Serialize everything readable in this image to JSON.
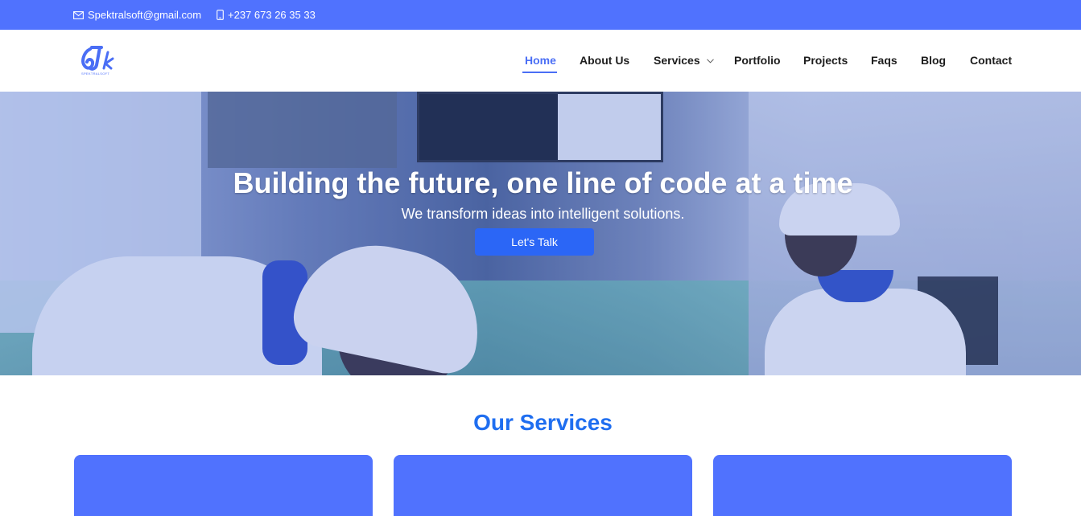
{
  "topbar": {
    "email": "Spektralsoft@gmail.com",
    "phone": "+237 673 26 35 33",
    "email_icon": "envelope-icon",
    "phone_icon": "mobile-phone-icon"
  },
  "brand": {
    "logo_text": "SPEKTRALSOFT"
  },
  "nav": {
    "items": [
      {
        "label": "Home",
        "active": true
      },
      {
        "label": "About Us"
      },
      {
        "label": "Services",
        "has_dropdown": true
      },
      {
        "label": "Portfolio"
      },
      {
        "label": "Projects"
      },
      {
        "label": "Faqs"
      },
      {
        "label": "Blog"
      },
      {
        "label": "Contact"
      }
    ]
  },
  "hero": {
    "title": "Building the future, one line of code at a time",
    "subtitle": "We transform ideas into intelligent solutions.",
    "cta_label": "Let's Talk"
  },
  "services": {
    "title": "Our Services",
    "cards": [
      {},
      {},
      {}
    ]
  },
  "colors": {
    "accent": "#5072fe",
    "cta": "#2b66f6",
    "section_title": "#1f6ef0",
    "nav_active": "#4a6ef5"
  }
}
